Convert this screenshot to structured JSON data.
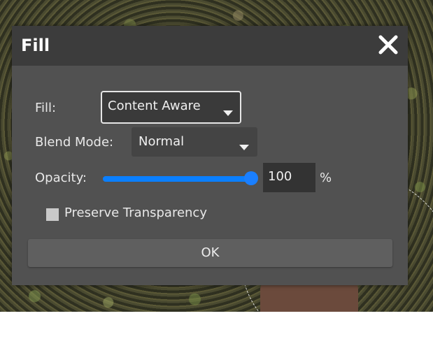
{
  "dialog": {
    "title": "Fill",
    "close_icon": "close-icon"
  },
  "fill": {
    "label": "Fill:",
    "value": "Content Aware",
    "caret_icon": "chevron-down-icon"
  },
  "blend": {
    "label": "Blend Mode:",
    "value": "Normal",
    "caret_icon": "chevron-down-icon"
  },
  "opacity": {
    "label": "Opacity:",
    "value": "100",
    "unit": "%",
    "slider_fraction": 1.0
  },
  "preserve": {
    "label": "Preserve Transparency",
    "checked": false
  },
  "ok": {
    "label": "OK"
  },
  "colors": {
    "accent": "#0a7fff",
    "dialog_bg": "#515151",
    "titlebar_bg": "#3c3c3c"
  }
}
